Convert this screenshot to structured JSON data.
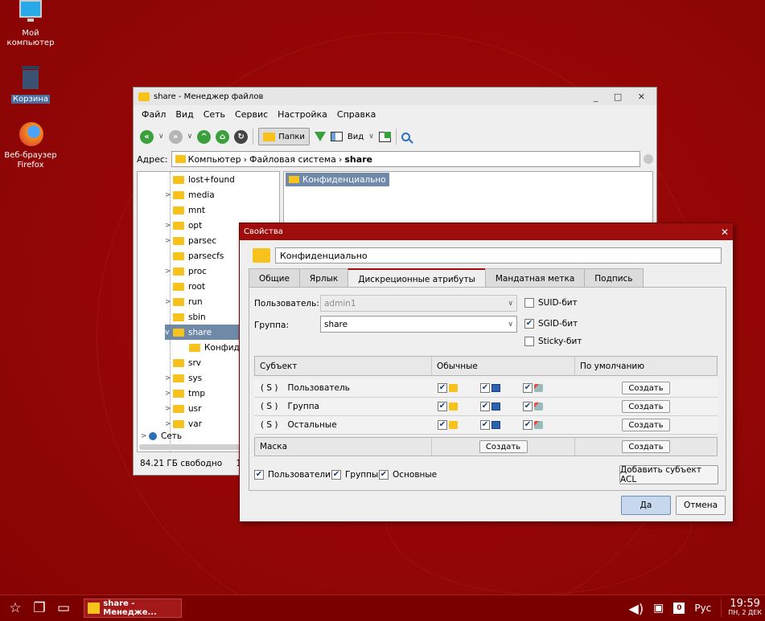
{
  "desktop": {
    "icons": [
      {
        "label": "Мой компьютер"
      },
      {
        "label": "Корзина"
      },
      {
        "label": "Веб-браузер Firefox"
      }
    ]
  },
  "file_manager": {
    "title": "share - Менеджер файлов",
    "menu": [
      "Файл",
      "Вид",
      "Сеть",
      "Сервис",
      "Настройка",
      "Справка"
    ],
    "toolbar": {
      "folders_label": "Папки",
      "view_label": "Вид"
    },
    "address": {
      "label": "Адрес:",
      "crumbs": [
        "Компьютер",
        "Файловая система",
        "share"
      ]
    },
    "tree": [
      {
        "name": "lost+found",
        "expander": ""
      },
      {
        "name": "media",
        "expander": ">"
      },
      {
        "name": "mnt",
        "expander": ""
      },
      {
        "name": "opt",
        "expander": ">"
      },
      {
        "name": "parsec",
        "expander": ">"
      },
      {
        "name": "parsecfs",
        "expander": ""
      },
      {
        "name": "proc",
        "expander": ">"
      },
      {
        "name": "root",
        "expander": ""
      },
      {
        "name": "run",
        "expander": ">"
      },
      {
        "name": "sbin",
        "expander": ""
      },
      {
        "name": "share",
        "expander": "v"
      },
      {
        "name": "Конфиден",
        "expander": ""
      },
      {
        "name": "srv",
        "expander": ""
      },
      {
        "name": "sys",
        "expander": ">"
      },
      {
        "name": "tmp",
        "expander": ">"
      },
      {
        "name": "usr",
        "expander": ">"
      },
      {
        "name": "var",
        "expander": ">"
      },
      {
        "name": "Сеть",
        "expander": ">"
      }
    ],
    "files": [
      {
        "name": "Конфиденциально"
      }
    ],
    "status": {
      "free": "84.21 ГБ свободно",
      "extra": "1 э"
    }
  },
  "dialog": {
    "title": "Свойства",
    "name": "Конфиденциально",
    "tabs": [
      "Общие",
      "Ярлык",
      "Дискреционные атрибуты",
      "Мандатная метка",
      "Подпись"
    ],
    "user_label": "Пользователь:",
    "user_value": "admin1",
    "group_label": "Группа:",
    "group_value": "share",
    "suid_label": "SUID-бит",
    "sgid_label": "SGID-бит",
    "sticky_label": "Sticky-бит",
    "acl_header": {
      "subject": "Субъект",
      "normal": "Обычные",
      "default": "По умолчанию"
    },
    "acl_rows": [
      {
        "tag": "( S )",
        "name": "Пользователь",
        "create": "Создать"
      },
      {
        "tag": "( S )",
        "name": "Группа",
        "create": "Создать"
      },
      {
        "tag": "( S )",
        "name": "Остальные",
        "create": "Создать"
      }
    ],
    "mask": {
      "label": "Маска",
      "create_normal": "Создать",
      "create_default": "Создать"
    },
    "filters": {
      "users": "Пользователи",
      "groups": "Группы",
      "basic": "Основные"
    },
    "add_acl": "Добавить субъект ACL",
    "ok": "Да",
    "cancel": "Отмена"
  },
  "taskbar": {
    "task": "share - Менедже...",
    "kb_badge": "0",
    "lang": "Рус",
    "time": "19:59",
    "date": "ПН, 2 ДЕК"
  }
}
